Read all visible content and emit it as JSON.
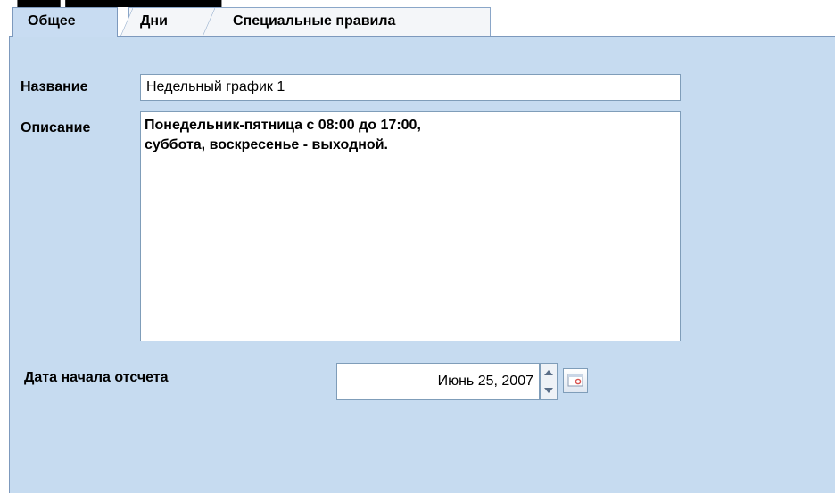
{
  "tabs": [
    {
      "label": "Общее",
      "active": true
    },
    {
      "label": "Дни",
      "active": false
    },
    {
      "label": "Специальные правила",
      "active": false
    }
  ],
  "form": {
    "name_label": "Название",
    "name_value": "Недельный график 1",
    "description_label": "Описание",
    "description_value": "Понедельник-пятница с 08:00 до 17:00,\nсуббота, воскресенье - выходной.",
    "start_date_label": "Дата начала отсчета",
    "start_date_value": "Июнь 25, 2007"
  },
  "icons": {
    "spinner_up": "arrow-up-icon",
    "spinner_down": "arrow-down-icon",
    "calendar": "calendar-icon"
  },
  "colors": {
    "panel_background": "#c6dbf0",
    "active_tab": "#c8dcf2",
    "border": "#7f9db9",
    "calendar_accent": "#d9534f"
  }
}
